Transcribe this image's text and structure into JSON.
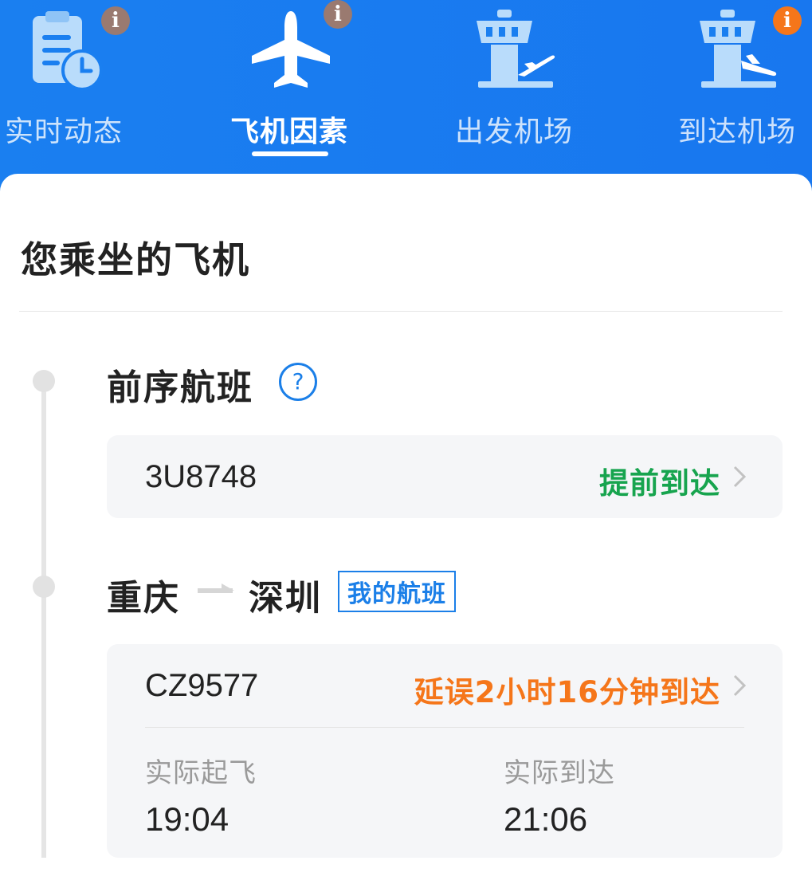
{
  "tabs": [
    {
      "label": "实时动态",
      "icon": "clipboard-clock-icon",
      "badge": "i",
      "badge_color": "#9a7a70",
      "active": false
    },
    {
      "label": "飞机因素",
      "icon": "airplane-icon",
      "badge": "i",
      "badge_color": "#9a7a70",
      "active": true
    },
    {
      "label": "出发机场",
      "icon": "departure-tower-icon",
      "badge": "",
      "active": false
    },
    {
      "label": "到达机场",
      "icon": "arrival-tower-icon",
      "badge": "i",
      "badge_color": "#f5761a",
      "active": false
    }
  ],
  "section": {
    "title": "您乘坐的飞机"
  },
  "previous_flight": {
    "title": "前序航班",
    "help_icon": "?",
    "flight_no": "3U8748",
    "status": "提前到达",
    "status_color": "#17a44e"
  },
  "my_flight": {
    "origin": "重庆",
    "destination": "深圳",
    "tag": "我的航班",
    "flight_no": "CZ9577",
    "status": "延误2小时16分钟到达",
    "status_color": "#f5761a",
    "departure_label": "实际起飞",
    "departure_time": "19:04",
    "arrival_label": "实际到达",
    "arrival_time": "21:06"
  },
  "colors": {
    "header_blue": "#1a7ff0",
    "accent_blue": "#1b7fe8"
  }
}
